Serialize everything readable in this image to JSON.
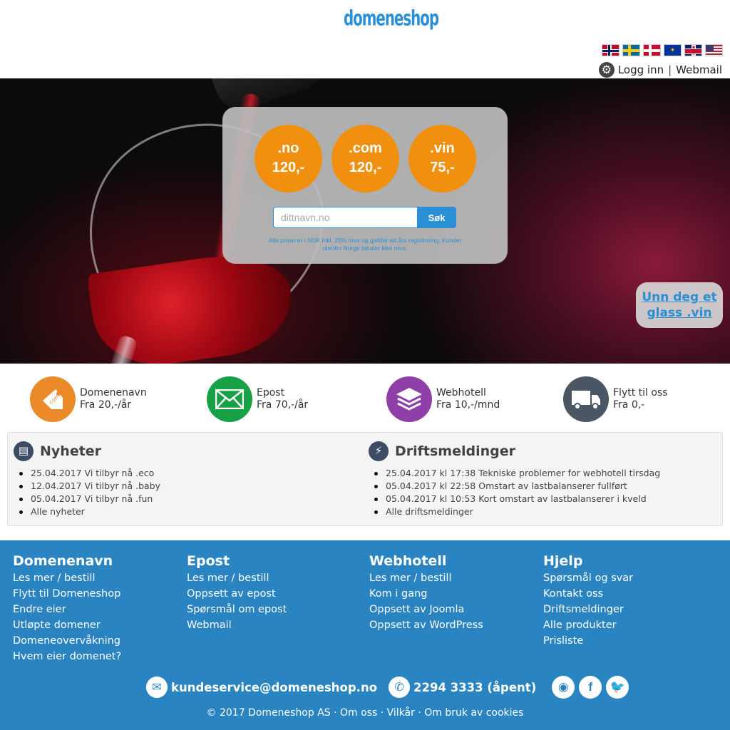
{
  "header": {
    "logo": "domeneshop",
    "flags": [
      "norway-flag",
      "sweden-flag",
      "denmark-flag",
      "eu-flag",
      "uk-flag",
      "us-flag"
    ],
    "login_label": "Logg inn",
    "separator": "|",
    "webmail_label": "Webmail"
  },
  "hero": {
    "prices": [
      {
        "tld": ".no",
        "price": "120,-"
      },
      {
        "tld": ".com",
        "price": "120,-"
      },
      {
        "tld": ".vin",
        "price": "75,-"
      }
    ],
    "search_placeholder": "dittnavn.no",
    "search_button": "Søk",
    "price_note": "Alle priser er i NOK inkl. 25% mva og gjelder ett års registrering. Kunder utenfor Norge betaler ikke mva.",
    "promo_line1": "Unn deg et",
    "promo_line2": "glass .vin",
    "accent_color": "#f0900e"
  },
  "products": [
    {
      "title": "Domenenavn",
      "price": "Fra 20,-/år",
      "icon": "tag-icon",
      "color": "#ec8a2a"
    },
    {
      "title": "Epost",
      "price": "Fra 70,-/år",
      "icon": "envelope-icon",
      "color": "#17a046"
    },
    {
      "title": "Webhotell",
      "price": "Fra 10,-/mnd",
      "icon": "layers-icon",
      "color": "#8e3fa8"
    },
    {
      "title": "Flytt til oss",
      "price": "Fra 0,-",
      "icon": "truck-icon",
      "color": "#4a5566"
    }
  ],
  "news": {
    "title": "Nyheter",
    "items": [
      "25.04.2017 Vi tilbyr nå .eco",
      "12.04.2017 Vi tilbyr nå .baby",
      "05.04.2017 Vi tilbyr nå .fun",
      "Alle nyheter"
    ]
  },
  "ops": {
    "title": "Driftsmeldinger",
    "items": [
      "25.04.2017 kl 17:38 Tekniske problemer for webhotell tirsdag",
      "05.04.2017 kl 22:58 Omstart av lastbalanserer fullført",
      "05.04.2017 kl 10:53 Kort omstart av lastbalanserer i kveld",
      "Alle driftsmeldinger"
    ]
  },
  "footer": {
    "columns": [
      {
        "title": "Domenenavn",
        "links": [
          "Les mer / bestill",
          "Flytt til Domeneshop",
          "Endre eier",
          "Utløpte domener",
          "Domeneovervåkning",
          "Hvem eier domenet?"
        ]
      },
      {
        "title": "Epost",
        "links": [
          "Les mer / bestill",
          "Oppsett av epost",
          "Spørsmål om epost",
          "Webmail"
        ]
      },
      {
        "title": "Webhotell",
        "links": [
          "Les mer / bestill",
          "Kom i gang",
          "Oppsett av Joomla",
          "Oppsett av WordPress"
        ]
      },
      {
        "title": "Hjelp",
        "links": [
          "Spørsmål og svar",
          "Kontakt oss",
          "Driftsmeldinger",
          "Alle produkter",
          "Prisliste"
        ]
      }
    ],
    "email": "kundeservice@domeneshop.no",
    "phone": "2294 3333 (åpent)",
    "copyright": "© 2017 Domeneshop AS · Om oss · Vilkår · Om bruk av cookies",
    "bg_color": "#2b84c2"
  }
}
